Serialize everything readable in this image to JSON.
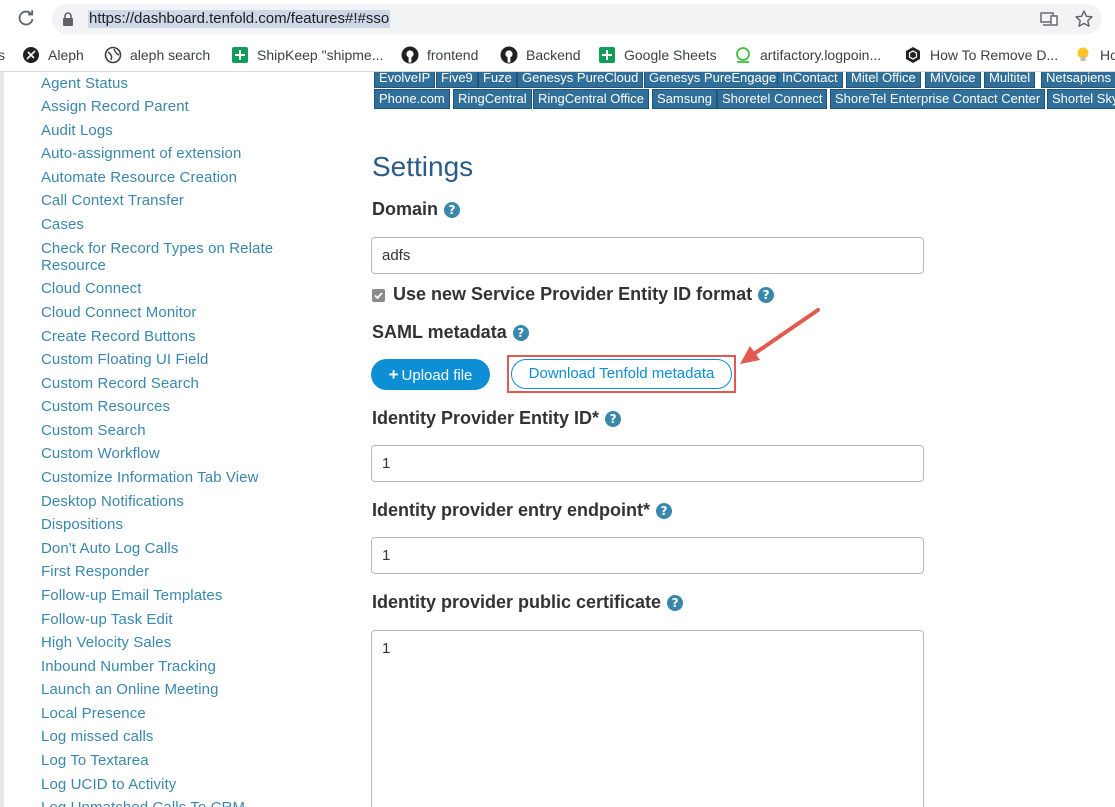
{
  "browser": {
    "url": "https://dashboard.tenfold.com/features#!#sso",
    "bookmarks": [
      {
        "label": "s",
        "icon": "none"
      },
      {
        "label": "Aleph",
        "icon": "aleph-icon"
      },
      {
        "label": "aleph search",
        "icon": "globe-icon"
      },
      {
        "label": "ShipKeep \"shipme...",
        "icon": "sheets-icon"
      },
      {
        "label": "frontend",
        "icon": "github-icon"
      },
      {
        "label": "Backend",
        "icon": "github-icon"
      },
      {
        "label": "Google Sheets",
        "icon": "sheets-icon"
      },
      {
        "label": "artifactory.logpoin...",
        "icon": "artifactory-icon"
      },
      {
        "label": "How To Remove D...",
        "icon": "hex-icon"
      },
      {
        "label": "Ho",
        "icon": "lightbulb-icon"
      }
    ]
  },
  "sidebar": {
    "items": [
      "Agent Status",
      "Assign Record Parent",
      "Audit Logs",
      "Auto-assignment of extension",
      "Automate Resource Creation",
      "Call Context Transfer",
      "Cases",
      "Check for Record Types on Relate",
      "Resource",
      "Cloud Connect",
      "Cloud Connect Monitor",
      "Create Record Buttons",
      "Custom Floating UI Field",
      "Custom Record Search",
      "Custom Resources",
      "Custom Search",
      "Custom Workflow",
      "Customize Information Tab View",
      "Desktop Notifications",
      "Dispositions",
      "Don't Auto Log Calls",
      "First Responder",
      "Follow-up Email Templates",
      "Follow-up Task Edit",
      "High Velocity Sales",
      "Inbound Number Tracking",
      "Launch an Online Meeting",
      "Local Presence",
      "Log missed calls",
      "Log To Textarea",
      "Log UCID to Activity",
      "Log Unmatched Calls To CRM"
    ]
  },
  "tags": {
    "row1": [
      "EvolveIP",
      "Five9",
      "Fuze",
      "Genesys PureCloud",
      "Genesys PureEngage",
      "InContact",
      "Mitel Office",
      "MiVoice",
      "Multitel",
      "Netsapiens"
    ],
    "row2": [
      "Phone.com",
      "RingCentral",
      "RingCentral Office",
      "Samsung",
      "Shoretel Connect",
      "ShoreTel Enterprise Contact Center",
      "Shortel Sky"
    ]
  },
  "settings": {
    "title": "Settings",
    "domain_label": "Domain",
    "domain_value": "adfs",
    "format_label": "Use new Service Provider Entity ID format",
    "format_checked": true,
    "saml_label": "SAML metadata",
    "upload_label": "Upload file",
    "download_label": "Download Tenfold metadata",
    "entity_id_label": "Identity Provider Entity ID*",
    "entity_id_value": "1",
    "endpoint_label": "Identity provider entry endpoint*",
    "endpoint_value": "1",
    "certificate_label": "Identity provider public certificate",
    "certificate_value": "1",
    "help_glyph": "?"
  },
  "colors": {
    "link": "#3a87ad",
    "heading": "#2a5c87",
    "tag_bg": "#2f6f99",
    "primary": "#0e8ed5",
    "annotation": "#e05a4f"
  }
}
